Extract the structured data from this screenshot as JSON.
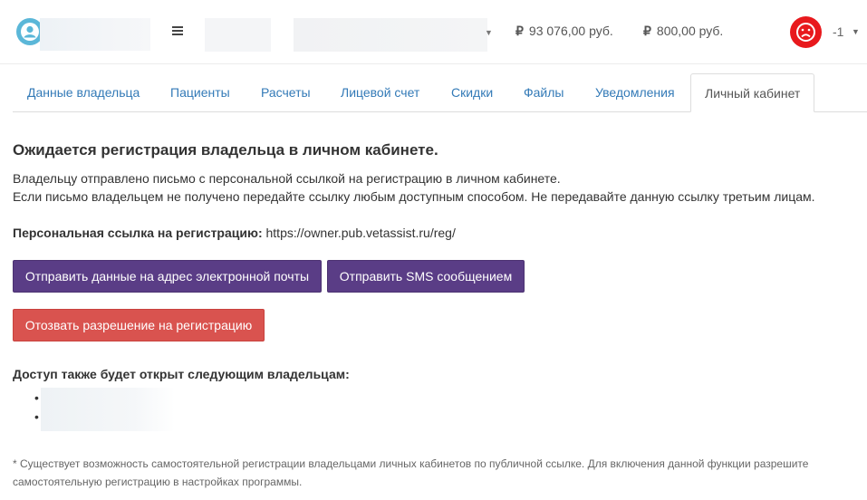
{
  "header": {
    "balance_1": "93 076,00 руб.",
    "balance_2": "800,00 руб.",
    "currency_icon": "₽",
    "status_count": "-1",
    "colors": {
      "status_bg": "#e8191d",
      "logo": "#5bb7d8"
    }
  },
  "tabs": [
    {
      "label": "Данные владельца"
    },
    {
      "label": "Пациенты"
    },
    {
      "label": "Расчеты"
    },
    {
      "label": "Лицевой счет"
    },
    {
      "label": "Скидки"
    },
    {
      "label": "Файлы"
    },
    {
      "label": "Уведомления"
    },
    {
      "label": "Личный кабинет",
      "active": true
    }
  ],
  "content": {
    "heading": "Ожидается регистрация владельца в личном кабинете.",
    "paragraph_1": "Владельцу отправлено письмо с персональной ссылкой на регистрацию в личном кабинете.",
    "paragraph_2": "Если письмо владельцем не получено передайте ссылку любым доступным способом. Не передавайте данную ссылку третьим лицам.",
    "link_label": "Персональная ссылка на регистрацию:",
    "link_url": "https://owner.pub.vetassist.ru/reg/",
    "btn_email": "Отправить данные на адрес электронной почты",
    "btn_sms": "Отправить SMS сообщением",
    "btn_revoke": "Отозвать разрешение на регистрацию",
    "access_title": "Доступ также будет открыт следующим владельцам:",
    "note_1": "* Существует возможность самостоятельной регистрации владельцами личных кабинетов по публичной ссылке. Для включения данной функции разрешите",
    "note_2": "самостоятельную регистрацию в настройках программы.",
    "colors": {
      "primary_button": "#5a3d86",
      "danger_button": "#d9534f",
      "tab_link": "#337ab7"
    }
  }
}
